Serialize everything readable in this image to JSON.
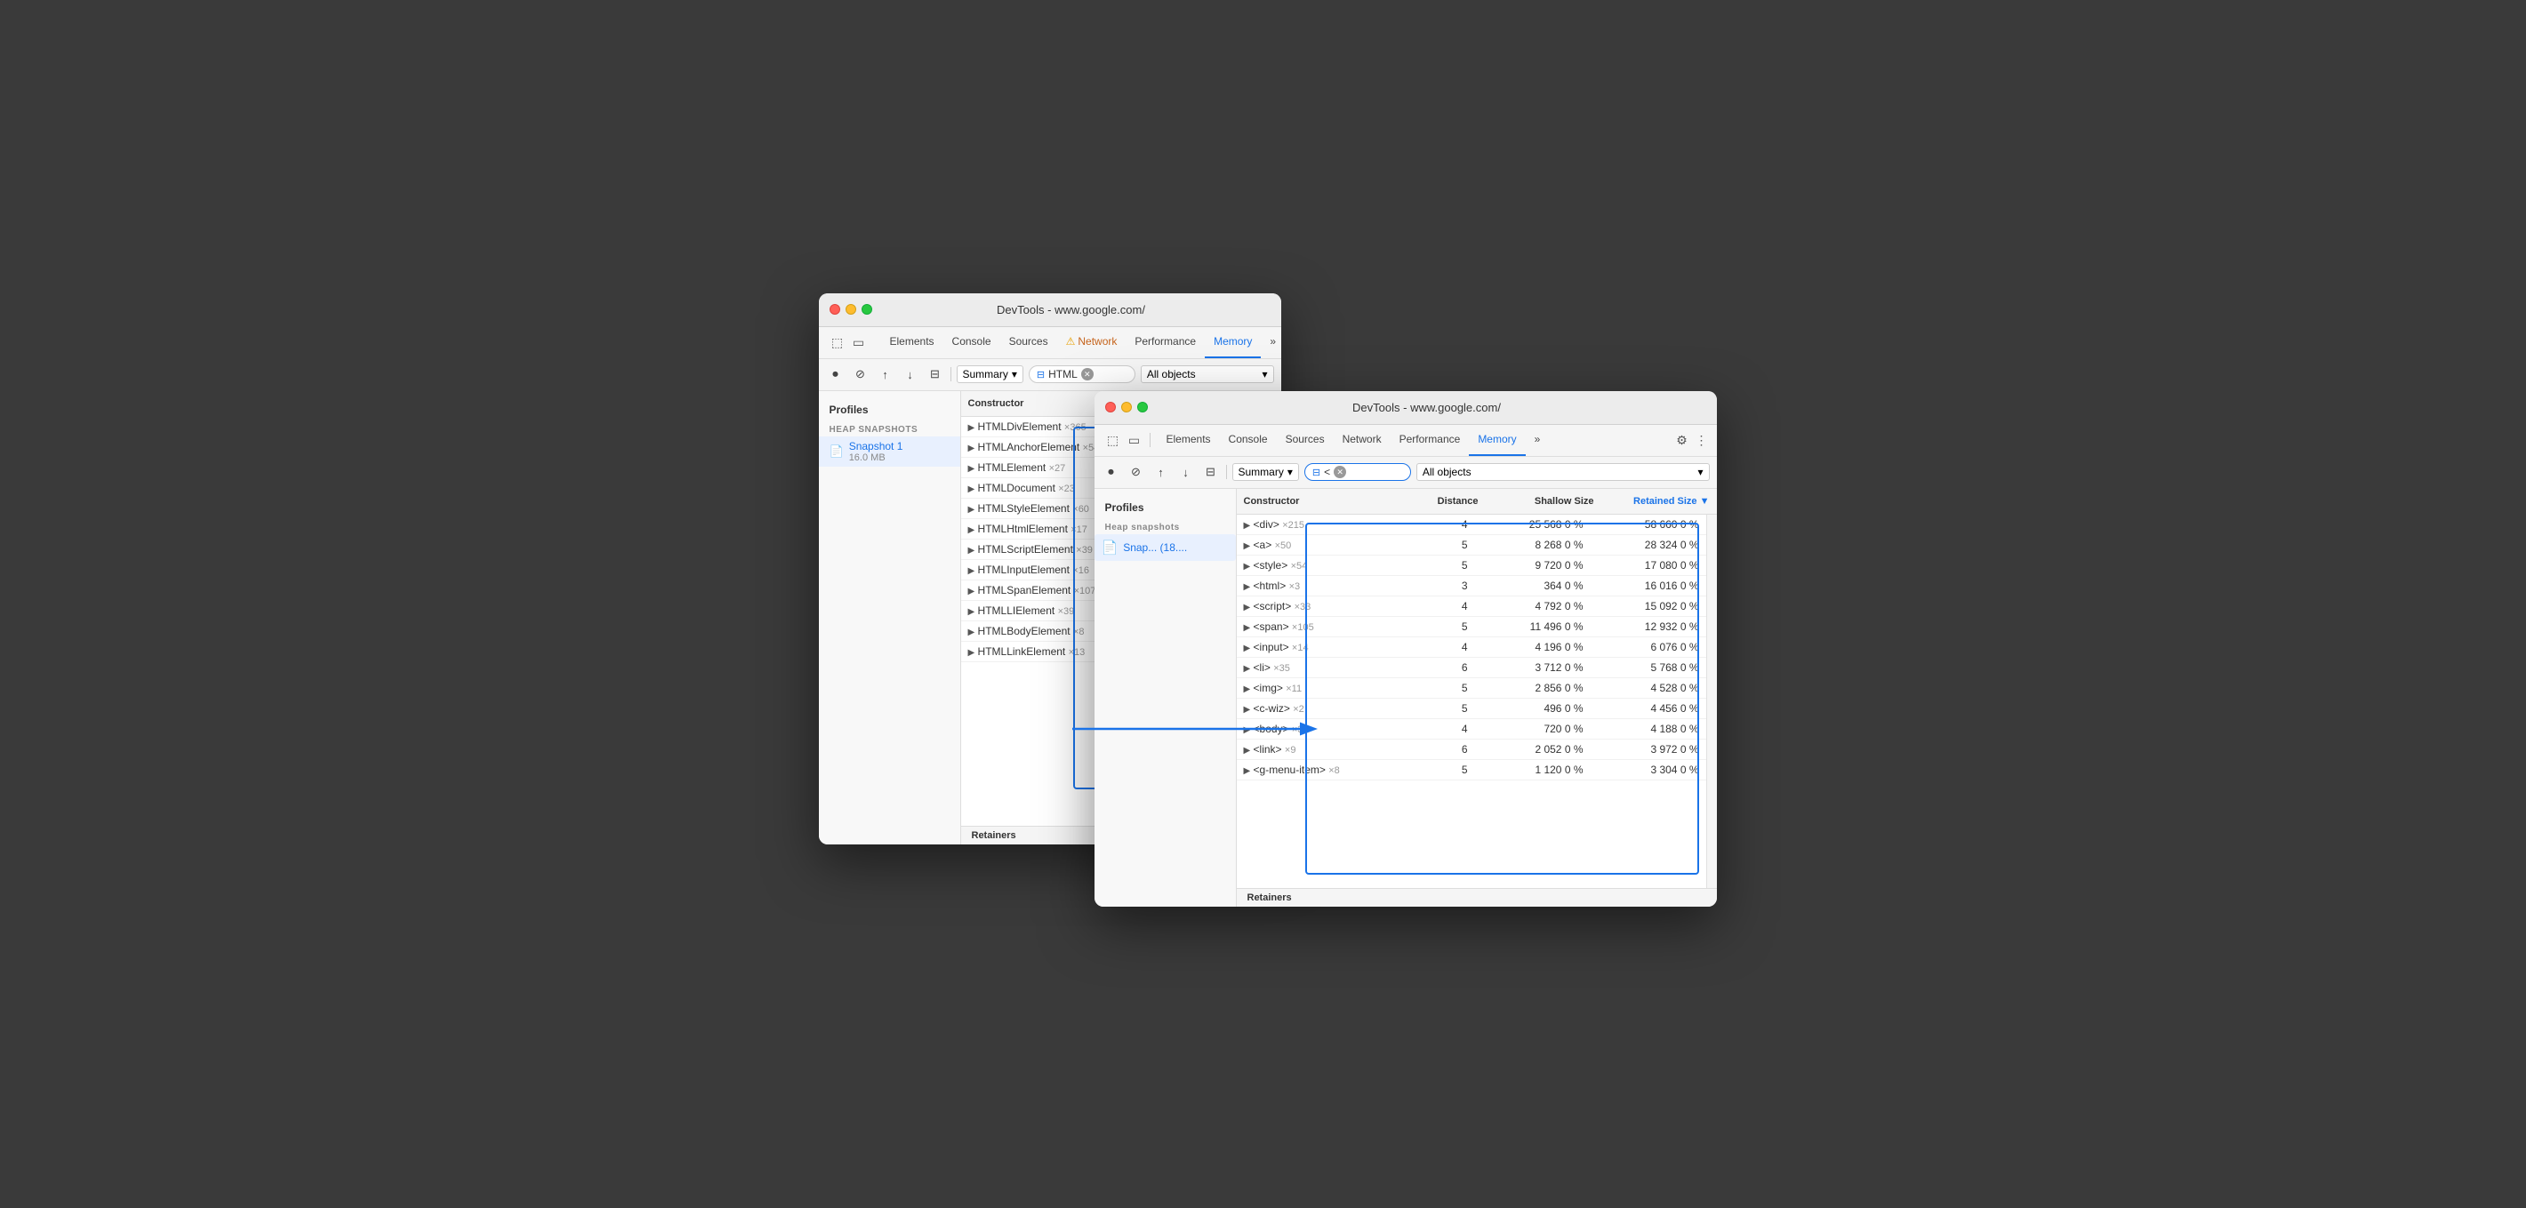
{
  "colors": {
    "accent": "#1a73e8",
    "highlight": "#1a73e8",
    "tl_red": "#ff5f57",
    "tl_yellow": "#febc2e",
    "tl_green": "#28c840"
  },
  "window_back": {
    "title": "DevTools - www.google.com/",
    "tabs": [
      {
        "label": "Elements",
        "active": false
      },
      {
        "label": "Console",
        "active": false
      },
      {
        "label": "Sources",
        "active": false
      },
      {
        "label": "Network",
        "active": false,
        "warning": true
      },
      {
        "label": "Performance",
        "active": false
      },
      {
        "label": "Memory",
        "active": true
      },
      {
        "label": "»",
        "active": false
      }
    ],
    "summary_label": "Summary",
    "filter_value": "HTML",
    "all_objects_label": "All objects",
    "sidebar": {
      "title": "Profiles",
      "section": "HEAP SNAPSHOTS",
      "items": [
        {
          "label": "Snapshot 1",
          "sub": "16.0 MB",
          "selected": true
        }
      ]
    },
    "constructor_header": "Constructor",
    "rows": [
      {
        "name": "HTMLDivElement",
        "count": "×365"
      },
      {
        "name": "HTMLAnchorElement",
        "count": "×54"
      },
      {
        "name": "HTMLElement",
        "count": "×27"
      },
      {
        "name": "HTMLDocument",
        "count": "×23"
      },
      {
        "name": "HTMLStyleElement",
        "count": "×60"
      },
      {
        "name": "HTMLHtmlElement",
        "count": "×17"
      },
      {
        "name": "HTMLScriptElement",
        "count": "×39"
      },
      {
        "name": "HTMLInputElement",
        "count": "×16"
      },
      {
        "name": "HTMLSpanElement",
        "count": "×107"
      },
      {
        "name": "HTMLLIElement",
        "count": "×39"
      },
      {
        "name": "HTMLBodyElement",
        "count": "×8"
      },
      {
        "name": "HTMLLinkElement",
        "count": "×13"
      }
    ],
    "retainers_label": "Retainers"
  },
  "window_front": {
    "title": "DevTools - www.google.com/",
    "tabs": [
      {
        "label": "Elements",
        "active": false
      },
      {
        "label": "Console",
        "active": false
      },
      {
        "label": "Sources",
        "active": false
      },
      {
        "label": "Network",
        "active": false
      },
      {
        "label": "Performance",
        "active": false
      },
      {
        "label": "Memory",
        "active": true
      },
      {
        "label": "»",
        "active": false
      }
    ],
    "summary_label": "Summary",
    "filter_value": "<",
    "all_objects_label": "All objects",
    "sidebar": {
      "title": "Profiles",
      "section": "Heap snapshots",
      "items": [
        {
          "label": "Snap... (18....",
          "selected": true
        }
      ]
    },
    "headers": {
      "constructor": "Constructor",
      "distance": "Distance",
      "shallow": "Shallow Size",
      "retained": "Retained Size"
    },
    "rows": [
      {
        "name": "<div>",
        "count": "×215",
        "distance": 4,
        "shallow": "25 568",
        "shallow_pct": "0 %",
        "retained": "58 660",
        "retained_pct": "0 %"
      },
      {
        "name": "<a>",
        "count": "×50",
        "distance": 5,
        "shallow": "8 268",
        "shallow_pct": "0 %",
        "retained": "28 324",
        "retained_pct": "0 %"
      },
      {
        "name": "<style>",
        "count": "×54",
        "distance": 5,
        "shallow": "9 720",
        "shallow_pct": "0 %",
        "retained": "17 080",
        "retained_pct": "0 %"
      },
      {
        "name": "<html>",
        "count": "×3",
        "distance": 3,
        "shallow": "364",
        "shallow_pct": "0 %",
        "retained": "16 016",
        "retained_pct": "0 %"
      },
      {
        "name": "<script>",
        "count": "×33",
        "distance": 4,
        "shallow": "4 792",
        "shallow_pct": "0 %",
        "retained": "15 092",
        "retained_pct": "0 %"
      },
      {
        "name": "<span>",
        "count": "×105",
        "distance": 5,
        "shallow": "11 496",
        "shallow_pct": "0 %",
        "retained": "12 932",
        "retained_pct": "0 %"
      },
      {
        "name": "<input>",
        "count": "×14",
        "distance": 4,
        "shallow": "4 196",
        "shallow_pct": "0 %",
        "retained": "6 076",
        "retained_pct": "0 %"
      },
      {
        "name": "<li>",
        "count": "×35",
        "distance": 6,
        "shallow": "3 712",
        "shallow_pct": "0 %",
        "retained": "5 768",
        "retained_pct": "0 %"
      },
      {
        "name": "<img>",
        "count": "×11",
        "distance": 5,
        "shallow": "2 856",
        "shallow_pct": "0 %",
        "retained": "4 528",
        "retained_pct": "0 %"
      },
      {
        "name": "<c-wiz>",
        "count": "×2",
        "distance": 5,
        "shallow": "496",
        "shallow_pct": "0 %",
        "retained": "4 456",
        "retained_pct": "0 %"
      },
      {
        "name": "<body>",
        "count": "×3",
        "distance": 4,
        "shallow": "720",
        "shallow_pct": "0 %",
        "retained": "4 188",
        "retained_pct": "0 %"
      },
      {
        "name": "<link>",
        "count": "×9",
        "distance": 6,
        "shallow": "2 052",
        "shallow_pct": "0 %",
        "retained": "3 972",
        "retained_pct": "0 %"
      },
      {
        "name": "<g-menu-item>",
        "count": "×8",
        "distance": 5,
        "shallow": "1 120",
        "shallow_pct": "0 %",
        "retained": "3 304",
        "retained_pct": "0 %"
      }
    ],
    "retainers_label": "Retainers"
  }
}
